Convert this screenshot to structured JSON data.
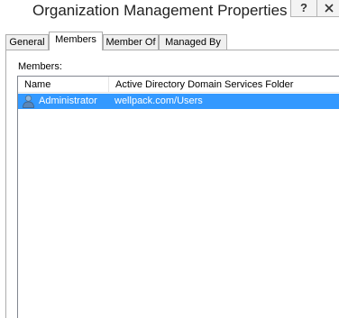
{
  "window": {
    "title": "Organization Management Properties",
    "help_label": "?"
  },
  "tabs": [
    {
      "label": "General",
      "active": false
    },
    {
      "label": "Members",
      "active": true
    },
    {
      "label": "Member Of",
      "active": false
    },
    {
      "label": "Managed By",
      "active": false
    }
  ],
  "members": {
    "label": "Members:",
    "columns": [
      "Name",
      "Active Directory Domain Services Folder"
    ],
    "rows": [
      {
        "name": "Administrator",
        "folder": "wellpack.com/Users",
        "icon": "user-icon",
        "selected": true
      }
    ]
  },
  "colors": {
    "selection": "#3399ff",
    "border": "#adadad"
  }
}
